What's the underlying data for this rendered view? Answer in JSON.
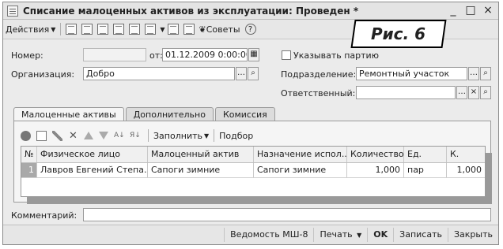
{
  "window": {
    "title": "Списание малоценных активов из эксплуатации: Проведен *",
    "controls": [
      "_",
      "□",
      "×"
    ]
  },
  "toolbar": {
    "actions_label": "Действия",
    "tips_label": "Советы",
    "help_icon": "?"
  },
  "figure_label": "Рис. 6",
  "form": {
    "number_label": "Номер:",
    "number_value": "",
    "date_label": "от:",
    "date_value": "01.12.2009  0:00:00",
    "specify_batch_label": "Указывать партию",
    "organization_label": "Организация:",
    "organization_value": "Добро",
    "subdivision_label": "Подразделение:",
    "subdivision_value": "Ремонтный участок",
    "responsible_label": "Ответственный:",
    "responsible_value": ""
  },
  "tabs": [
    {
      "label": "Малоценные активы"
    },
    {
      "label": "Дополнительно"
    },
    {
      "label": "Комиссия"
    }
  ],
  "table_toolbar": {
    "fill_label": "Заполнить",
    "select_label": "Подбор"
  },
  "table": {
    "columns": [
      "№",
      "Физическое лицо",
      "Малоценный актив",
      "Назначение испол...",
      "Количество",
      "Ед.",
      "К."
    ],
    "rows": [
      [
        "1",
        "Лавров Евгений Степа...",
        "Сапоги зимние",
        "Сапоги зимние",
        "1,000",
        "пар",
        "1,000"
      ]
    ]
  },
  "comment": {
    "label": "Комментарий:",
    "value": ""
  },
  "footer": {
    "report_label": "Ведомость МШ-8",
    "print_label": "Печать",
    "ok_label": "OK",
    "save_label": "Записать",
    "close_label": "Закрыть"
  }
}
